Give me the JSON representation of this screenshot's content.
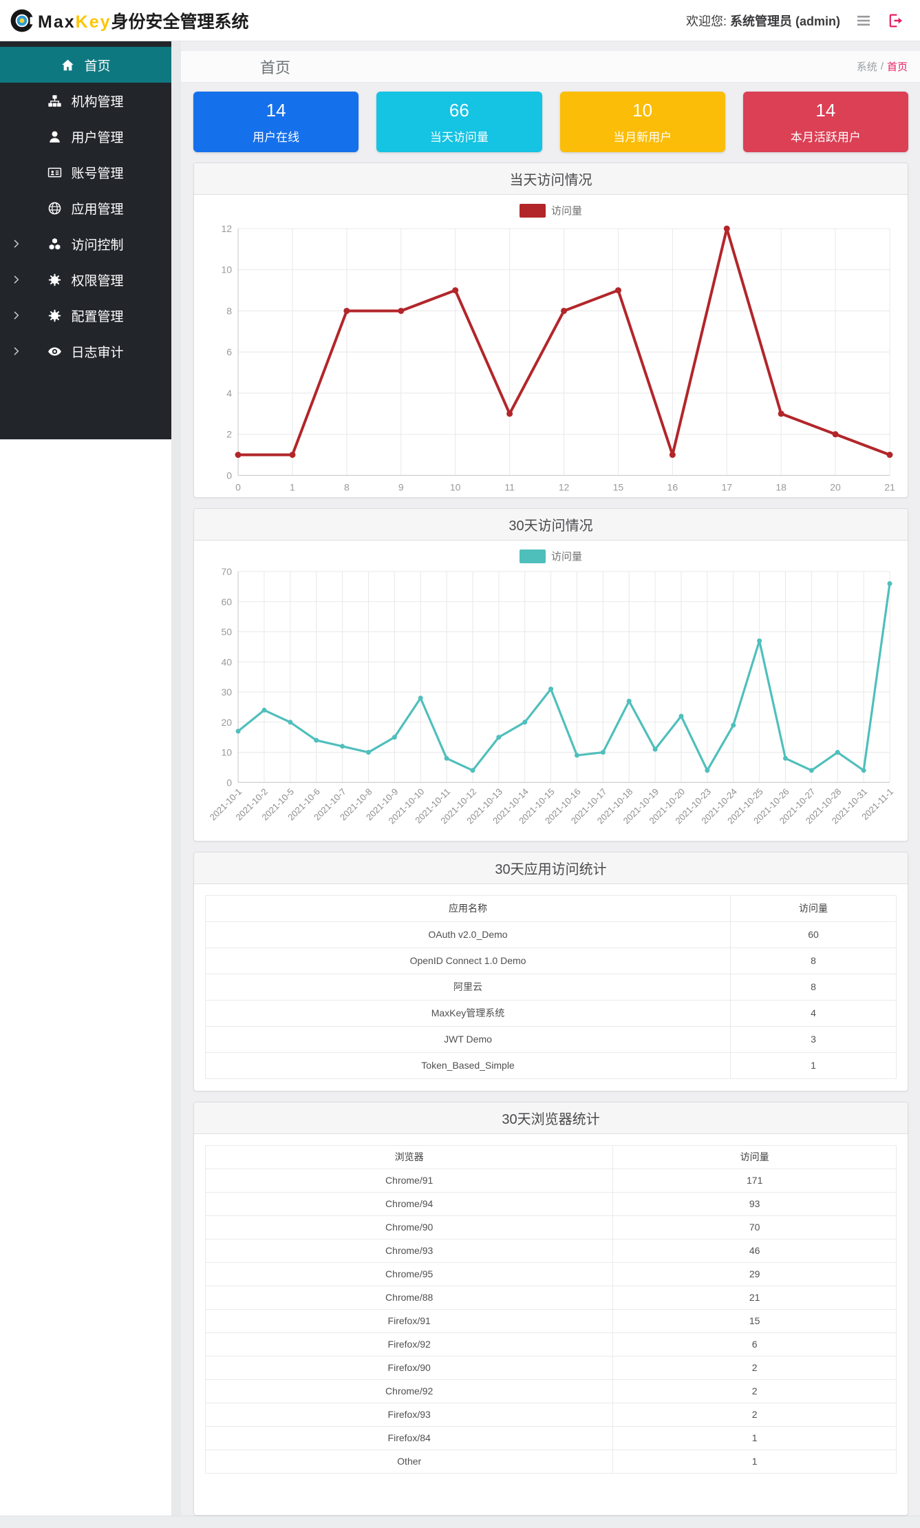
{
  "header": {
    "logo_text_max": "Max",
    "logo_text_key": "Key",
    "logo_text_suffix": "身份安全管理系统",
    "welcome_prefix": "欢迎您:",
    "welcome_user": "系统管理员 (admin)"
  },
  "sidebar": {
    "items": [
      {
        "name": "home",
        "label": "首页",
        "icon": "home",
        "active": true,
        "expandable": false
      },
      {
        "name": "org",
        "label": "机构管理",
        "icon": "sitemap",
        "active": false,
        "expandable": false
      },
      {
        "name": "users",
        "label": "用户管理",
        "icon": "user",
        "active": false,
        "expandable": false
      },
      {
        "name": "accounts",
        "label": "账号管理",
        "icon": "id-card",
        "active": false,
        "expandable": false
      },
      {
        "name": "apps",
        "label": "应用管理",
        "icon": "globe",
        "active": false,
        "expandable": false
      },
      {
        "name": "access-control",
        "label": "访问控制",
        "icon": "cubes",
        "active": false,
        "expandable": true
      },
      {
        "name": "permissions",
        "label": "权限管理",
        "icon": "cogs",
        "active": false,
        "expandable": true
      },
      {
        "name": "config",
        "label": "配置管理",
        "icon": "cogs",
        "active": false,
        "expandable": true
      },
      {
        "name": "audit",
        "label": "日志审计",
        "icon": "eye",
        "active": false,
        "expandable": true
      }
    ]
  },
  "breadcrumb": {
    "title": "首页",
    "path_root": "系统",
    "path_sep": "/",
    "path_current": "首页"
  },
  "stat_cards": [
    {
      "value": "14",
      "label": "用户在线",
      "color": "#1570eb"
    },
    {
      "value": "66",
      "label": "当天访问量",
      "color": "#15c3e3"
    },
    {
      "value": "10",
      "label": "当月新用户",
      "color": "#fbbd08"
    },
    {
      "value": "14",
      "label": "本月活跃用户",
      "color": "#db4055"
    }
  ],
  "chart_data": [
    {
      "type": "line",
      "title": "当天访问情况",
      "legend": "访问量",
      "color": "#b2262a",
      "categories": [
        "0",
        "1",
        "8",
        "9",
        "10",
        "11",
        "12",
        "15",
        "16",
        "17",
        "18",
        "20",
        "21"
      ],
      "values": [
        1,
        1,
        8,
        8,
        9,
        3,
        8,
        9,
        1,
        12,
        3,
        2,
        1
      ],
      "xlabel": "",
      "ylabel": "",
      "ylim": [
        0,
        12
      ],
      "ytick_step": 2,
      "grid": true,
      "legend_position": "top",
      "rotate_labels": false
    },
    {
      "type": "line",
      "title": "30天访问情况",
      "legend": "访问量",
      "color": "#4fbfbc",
      "categories": [
        "2021-10-1",
        "2021-10-2",
        "2021-10-5",
        "2021-10-6",
        "2021-10-7",
        "2021-10-8",
        "2021-10-9",
        "2021-10-10",
        "2021-10-11",
        "2021-10-12",
        "2021-10-13",
        "2021-10-14",
        "2021-10-15",
        "2021-10-16",
        "2021-10-17",
        "2021-10-18",
        "2021-10-19",
        "2021-10-20",
        "2021-10-23",
        "2021-10-24",
        "2021-10-25",
        "2021-10-26",
        "2021-10-27",
        "2021-10-28",
        "2021-10-31",
        "2021-11-1"
      ],
      "values": [
        17,
        24,
        20,
        14,
        12,
        10,
        15,
        28,
        8,
        4,
        15,
        20,
        31,
        9,
        10,
        27,
        11,
        22,
        4,
        19,
        47,
        8,
        4,
        10,
        4,
        66
      ],
      "xlabel": "",
      "ylabel": "",
      "ylim": [
        0,
        70
      ],
      "ytick_step": 10,
      "grid": true,
      "legend_position": "top",
      "rotate_labels": true
    }
  ],
  "app_table": {
    "title": "30天应用访问统计",
    "headers": [
      "应用名称",
      "访问量"
    ],
    "rows": [
      [
        "OAuth v2.0_Demo",
        "60"
      ],
      [
        "OpenID Connect 1.0 Demo",
        "8"
      ],
      [
        "阿里云",
        "8"
      ],
      [
        "MaxKey管理系统",
        "4"
      ],
      [
        "JWT Demo",
        "3"
      ],
      [
        "Token_Based_Simple",
        "1"
      ]
    ]
  },
  "browser_table": {
    "title": "30天浏览器统计",
    "headers": [
      "浏览器",
      "访问量"
    ],
    "rows": [
      [
        "Chrome/91",
        "171"
      ],
      [
        "Chrome/94",
        "93"
      ],
      [
        "Chrome/90",
        "70"
      ],
      [
        "Chrome/93",
        "46"
      ],
      [
        "Chrome/95",
        "29"
      ],
      [
        "Chrome/88",
        "21"
      ],
      [
        "Firefox/91",
        "15"
      ],
      [
        "Firefox/92",
        "6"
      ],
      [
        "Firefox/90",
        "2"
      ],
      [
        "Chrome/92",
        "2"
      ],
      [
        "Firefox/93",
        "2"
      ],
      [
        "Firefox/84",
        "1"
      ],
      [
        "Other",
        "1"
      ]
    ]
  }
}
